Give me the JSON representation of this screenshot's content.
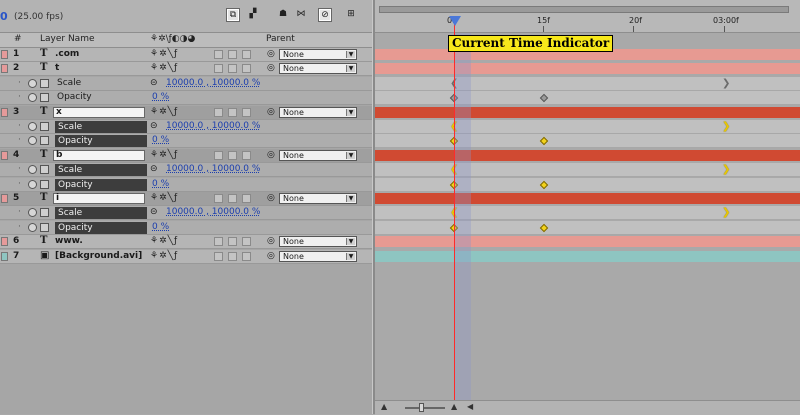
{
  "toolbar": {
    "time_value": "0",
    "fps": "(25.00 fps)"
  },
  "header": {
    "num": "#",
    "layer_name": "Layer Name",
    "switches": "⚘✲\\ƒ◐◑◕",
    "parent": "Parent"
  },
  "rows": [
    {
      "kind": "layer",
      "num": "1",
      "icon": "T",
      "name": ".com",
      "chip": "#e59a9a",
      "parent": "None"
    },
    {
      "kind": "layer",
      "num": "2",
      "icon": "T",
      "name": "t",
      "chip": "#e59a9a",
      "parent": "None"
    },
    {
      "kind": "prop",
      "name": "Scale",
      "value": "10000.0 , 10000.0 %"
    },
    {
      "kind": "prop",
      "name": "Opacity",
      "value": "0 %"
    },
    {
      "kind": "layer",
      "num": "3",
      "icon": "T",
      "name": "x",
      "chip": "#e59a9a",
      "parent": "None",
      "selected": true
    },
    {
      "kind": "prop",
      "name": "Scale",
      "value": "10000.0 , 10000.0 %",
      "selected": true
    },
    {
      "kind": "prop",
      "name": "Opacity",
      "value": "0 %",
      "selected": true
    },
    {
      "kind": "layer",
      "num": "4",
      "icon": "T",
      "name": "b",
      "chip": "#e59a9a",
      "parent": "None",
      "selected": true
    },
    {
      "kind": "prop",
      "name": "Scale",
      "value": "10000.0 , 10000.0 %",
      "selected": true
    },
    {
      "kind": "prop",
      "name": "Opacity",
      "value": "0 %",
      "selected": true
    },
    {
      "kind": "layer",
      "num": "5",
      "icon": "T",
      "name": "i",
      "chip": "#e59a9a",
      "parent": "None",
      "selected": true
    },
    {
      "kind": "prop",
      "name": "Scale",
      "value": "10000.0 , 10000.0 %",
      "selected": true
    },
    {
      "kind": "prop",
      "name": "Opacity",
      "value": "0 %",
      "selected": true
    },
    {
      "kind": "layer",
      "num": "6",
      "icon": "T",
      "name": "www.",
      "chip": "#e59a9a",
      "parent": "None"
    },
    {
      "kind": "layer",
      "num": "7",
      "icon": "▣",
      "name": "[Background.avi]",
      "chip": "#8ec5c1",
      "parent": "None"
    }
  ],
  "timeline": {
    "ticks": [
      "0f",
      "15f",
      "20f",
      "03:00f"
    ],
    "callout": "Current Time Indicator"
  },
  "colors": {
    "pink_bar": "#e79a92",
    "red_bar": "#d04a32",
    "teal_bar": "#8ec5c1",
    "cti": "#ff2a2a",
    "callout_bg": "#f7e81b",
    "keyframe_selected": "#f2d21a"
  }
}
